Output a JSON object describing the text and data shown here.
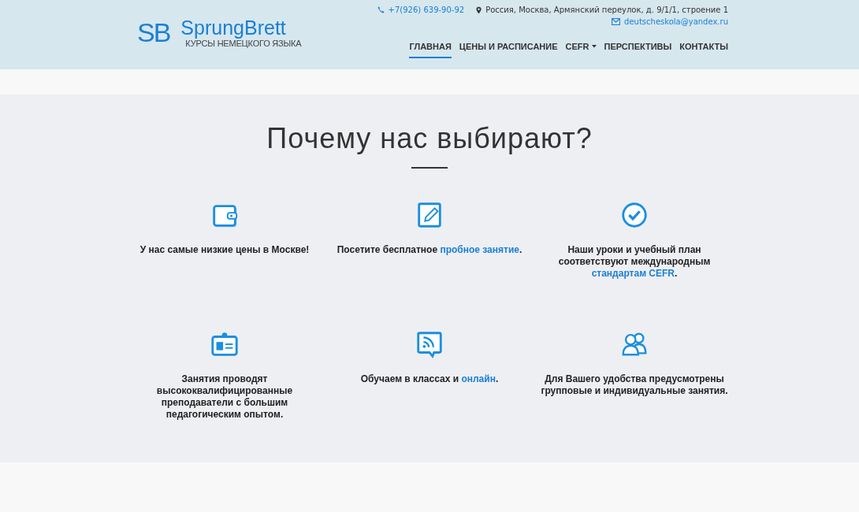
{
  "header": {
    "logo_mark": "SB",
    "brand": "SprungBrett",
    "tagline": "КУРСЫ НЕМЕЦКОГО ЯЗЫКА",
    "phone": "+7(926) 639-90-92",
    "address": "Россия, Москва, Армянский переулок, д. 9/1/1, строение 1",
    "email": "deutscheskola@yandex.ru"
  },
  "nav": [
    {
      "label": "ГЛАВНАЯ",
      "selected": true,
      "dropdown": false
    },
    {
      "label": "ЦЕНЫ И РАСПИСАНИЕ",
      "selected": false,
      "dropdown": false
    },
    {
      "label": "CEFR",
      "selected": false,
      "dropdown": true
    },
    {
      "label": "ПЕРСПЕКТИВЫ",
      "selected": false,
      "dropdown": false
    },
    {
      "label": "КОНТАКТЫ",
      "selected": false,
      "dropdown": false
    }
  ],
  "section": {
    "title": "Почему нас выбирают?"
  },
  "features": [
    {
      "kind": "wallet",
      "parts": [
        {
          "kind": "text",
          "text": "У нас самые низкие цены в Москве!"
        }
      ]
    },
    {
      "kind": "notepad",
      "parts": [
        {
          "kind": "text",
          "text": "Посетите бесплатное"
        },
        {
          "kind": "link",
          "text": "пробное занятие"
        },
        {
          "kind": "text",
          "text": "."
        }
      ]
    },
    {
      "kind": "check",
      "parts": [
        {
          "kind": "text",
          "text": "Наши уроки и учебный план соответствуют международным"
        },
        {
          "kind": "link",
          "text": "стандартам CEFR"
        },
        {
          "kind": "text",
          "text": "."
        }
      ]
    },
    {
      "kind": "idcard",
      "parts": [
        {
          "kind": "text",
          "text": "Занятия проводят высококвалифицированные преподаватели с большим педагогическим опытом."
        }
      ]
    },
    {
      "kind": "rss",
      "parts": [
        {
          "kind": "text",
          "text": "Обучаем в классах и"
        },
        {
          "kind": "link",
          "text": "онлайн"
        },
        {
          "kind": "text",
          "text": "."
        }
      ]
    },
    {
      "kind": "users",
      "parts": [
        {
          "kind": "text",
          "text": "Для Вашего удобства предусмотрены групповые и индивидуальные занятия."
        }
      ]
    }
  ]
}
